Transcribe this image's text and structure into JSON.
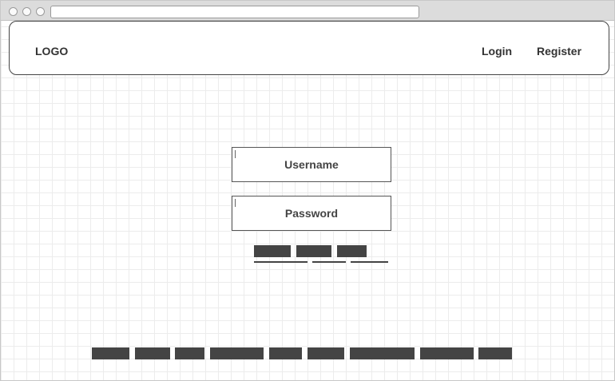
{
  "header": {
    "logo": "LOGO",
    "nav": {
      "login": "Login",
      "register": "Register"
    }
  },
  "login_form": {
    "username_placeholder": "Username",
    "password_placeholder": "Password"
  },
  "colors": {
    "placeholder_block": "#444444",
    "grid_line": "#ececec",
    "border": "#444444"
  }
}
